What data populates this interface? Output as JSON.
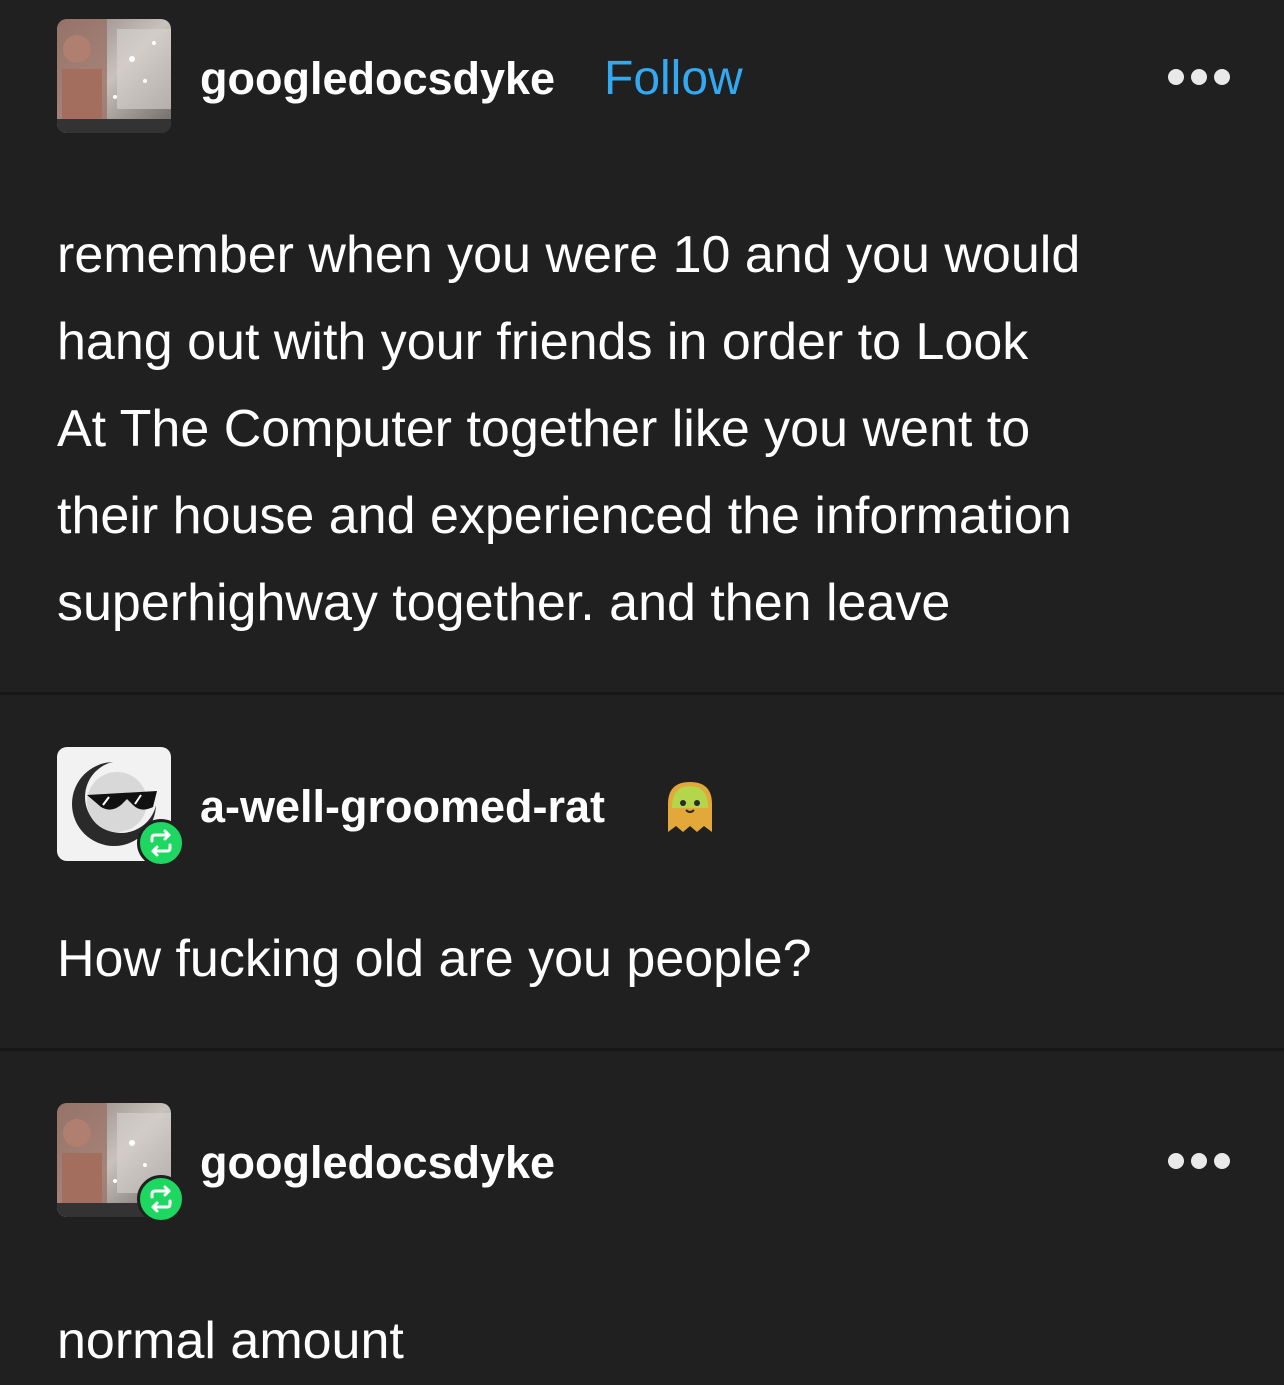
{
  "posts": [
    {
      "username": "googledocsdyke",
      "follow_label": "Follow",
      "more_icon": "more-options-icon",
      "text": "remember when you were 10 and you would\nhang out with your friends in order to Look\nAt The Computer together like you went to\ntheir house and experienced the information\nsuperhighway together. and then leave"
    },
    {
      "username": "a-well-groomed-rat",
      "badge_icon": "ghost-emoji-icon",
      "reblog_icon": "reblog-icon",
      "text": "How fucking old are you people?"
    },
    {
      "username": "googledocsdyke",
      "more_icon": "more-options-icon",
      "reblog_icon": "reblog-icon",
      "text": "normal amount"
    }
  ],
  "colors": {
    "background": "#202020",
    "divider": "#171717",
    "text": "#ffffff",
    "follow": "#33a9f2",
    "reblog_badge": "#1ed760"
  }
}
